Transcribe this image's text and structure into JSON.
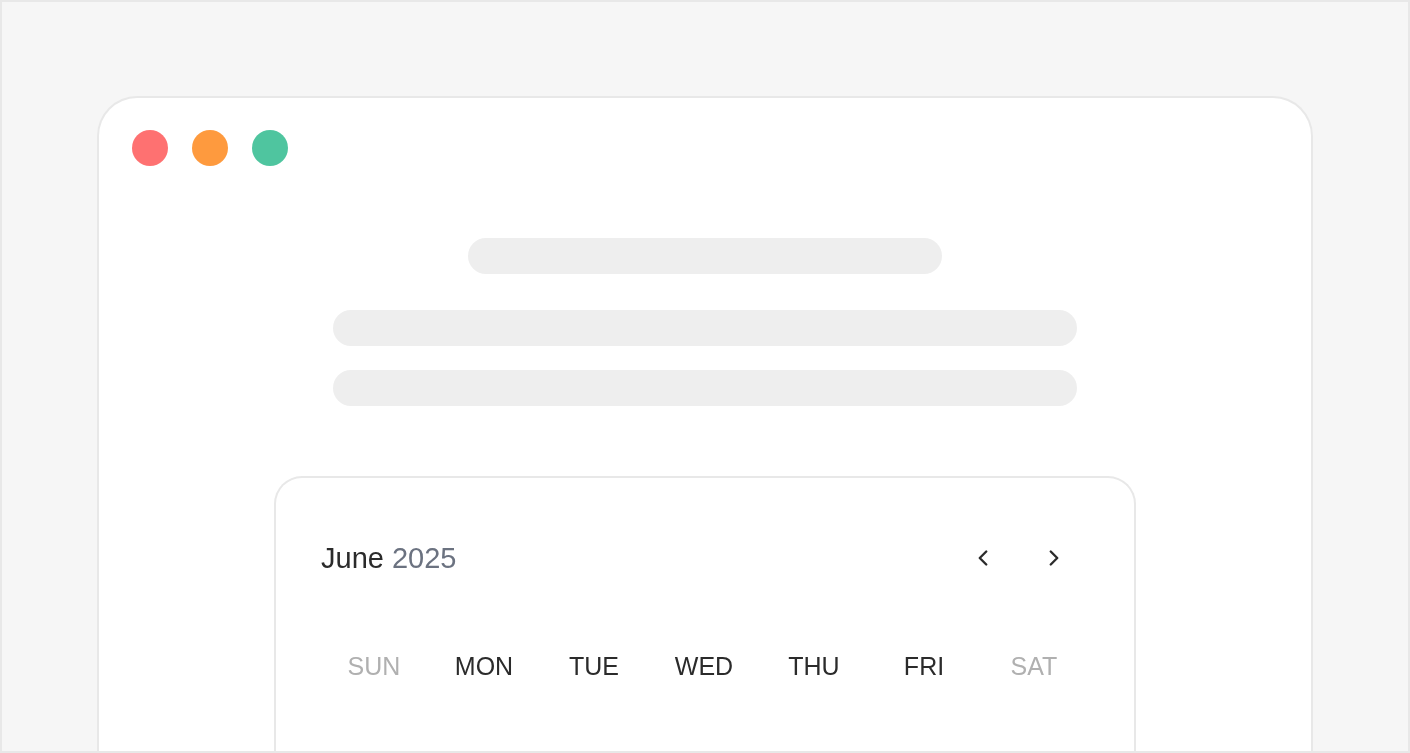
{
  "calendar": {
    "month": "June",
    "year": "2025",
    "weekdays": [
      {
        "label": "SUN",
        "weekend": true
      },
      {
        "label": "MON",
        "weekend": false
      },
      {
        "label": "TUE",
        "weekend": false
      },
      {
        "label": "WED",
        "weekend": false
      },
      {
        "label": "THU",
        "weekend": false
      },
      {
        "label": "FRI",
        "weekend": false
      },
      {
        "label": "SAT",
        "weekend": true
      }
    ]
  }
}
